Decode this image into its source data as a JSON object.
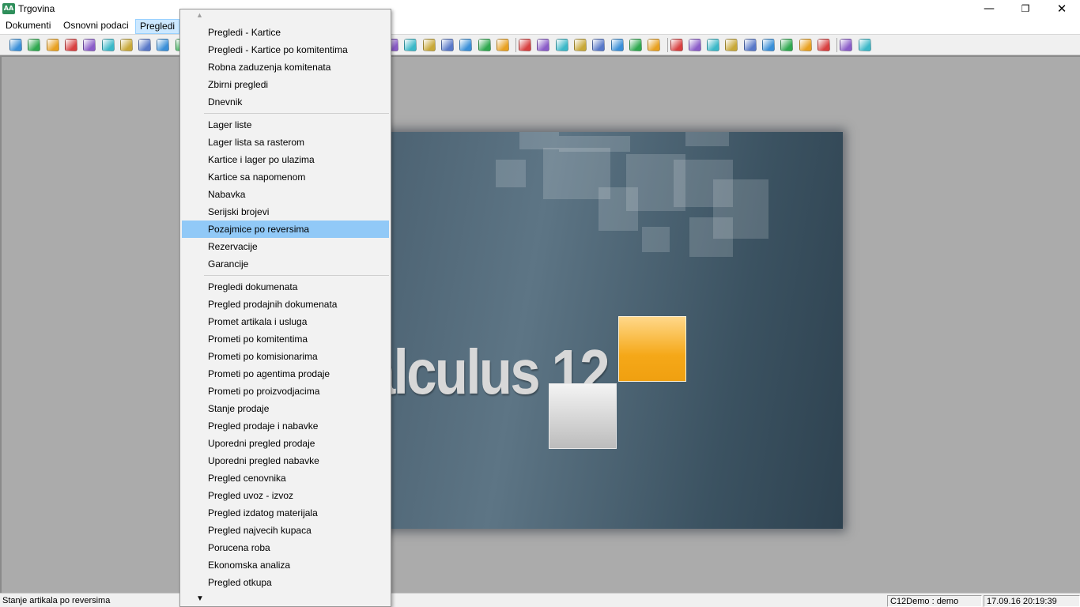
{
  "window": {
    "title": "Trgovina",
    "icon_label": "AA",
    "minimize_glyph": "—",
    "maximize_glyph": "❐",
    "close_glyph": "✕"
  },
  "menubar": {
    "items": [
      "Dokumenti",
      "Osnovni podaci",
      "Pregledi"
    ],
    "active": "Pregledi"
  },
  "toolbar": {
    "icons": [
      "info-icon",
      "refresh-icon",
      "globe-icon",
      "arrow-right-icon",
      "export-icon",
      "import-icon",
      "home-icon",
      "user-icon",
      "settings-icon",
      "archive-icon",
      "folder-icon",
      "mail-icon",
      "save-icon",
      "print-icon",
      "back-icon",
      "send-icon",
      "next-icon",
      "prev-icon",
      "star-icon",
      "edit-icon",
      "document-icon",
      "letter-icon",
      "pencil-icon",
      "copy-icon",
      "delete-icon",
      "upload-icon",
      "download-icon",
      "calendar-icon",
      "refresh-doc-icon",
      "sum-icon",
      "grid-icon",
      "list-icon",
      "table-icon",
      "cards-icon",
      "window-icon",
      "view-icon",
      "notes-icon",
      "bulb-icon",
      "gear-icon",
      "tag-icon",
      "stack-icon",
      "heart-icon",
      "note-icon",
      "calculator-icon",
      "help-icon",
      "exit-icon"
    ]
  },
  "splash": {
    "text": "alculus 12"
  },
  "dropdown": {
    "groups": [
      [
        "Pregledi - Kartice",
        "Pregledi - Kartice po komitentima",
        "Robna zaduzenja komitenata",
        "Zbirni pregledi",
        "Dnevnik"
      ],
      [
        "Lager liste",
        "Lager lista sa rasterom",
        "Kartice i lager po ulazima",
        "Kartice sa napomenom",
        "Nabavka",
        "Serijski brojevi",
        "Pozajmice po reversima",
        "Rezervacije",
        "Garancije"
      ],
      [
        "Pregledi dokumenata",
        "Pregled prodajnih dokumenata",
        "Promet artikala i usluga",
        "Prometi po komitentima",
        "Prometi po komisionarima",
        "Prometi po agentima prodaje",
        "Prometi po proizvodjacima",
        "Stanje prodaje",
        "Pregled prodaje i nabavke",
        "Uporedni pregled prodaje",
        "Uporedni pregled nabavke",
        "Pregled cenovnika",
        "Pregled uvoz - izvoz",
        "Pregled izdatog materijala",
        "Pregled najvecih kupaca",
        "Porucena roba",
        "Ekonomska analiza",
        "Pregled otkupa"
      ]
    ],
    "highlighted": "Pozajmice po reversima",
    "scroll_up_glyph": "▲",
    "scroll_down_glyph": "▼"
  },
  "statusbar": {
    "message": "Stanje artikala po reversima",
    "user": "C12Demo : demo",
    "datetime": "17.09.16 20:19:39"
  },
  "colors": {
    "highlight": "#91c9f7",
    "menu_active": "#cce8ff",
    "client_bg": "#ababab",
    "accent_orange": "#f5a818"
  }
}
